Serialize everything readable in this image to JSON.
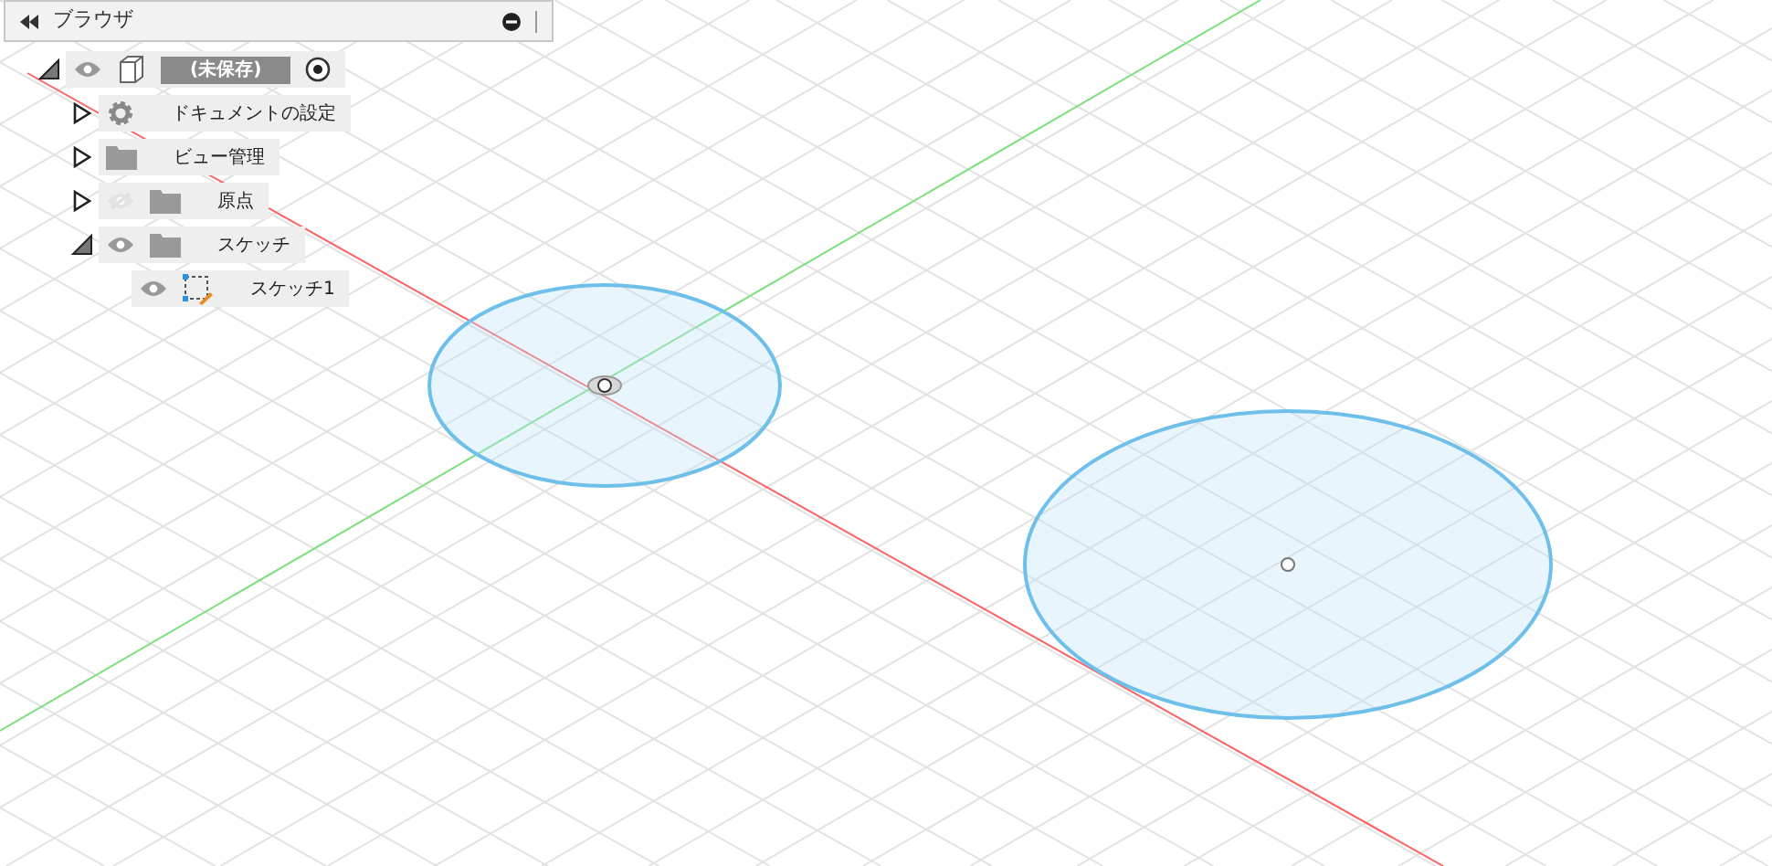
{
  "browser": {
    "title": "ブラウザ"
  },
  "tree": [
    {
      "label": "(未保存)",
      "kind": "component",
      "expanded": true,
      "visible": true,
      "selected": true,
      "children": [
        {
          "label": "ドキュメントの設定",
          "kind": "settings",
          "expanded": false
        },
        {
          "label": "ビュー管理",
          "kind": "folder",
          "expanded": false
        },
        {
          "label": "原点",
          "kind": "folder",
          "expanded": false,
          "visible": false
        },
        {
          "label": "スケッチ",
          "kind": "folder",
          "expanded": true,
          "visible": true,
          "children": [
            {
              "label": "スケッチ1",
              "kind": "sketch",
              "visible": true
            }
          ]
        }
      ]
    }
  ]
}
